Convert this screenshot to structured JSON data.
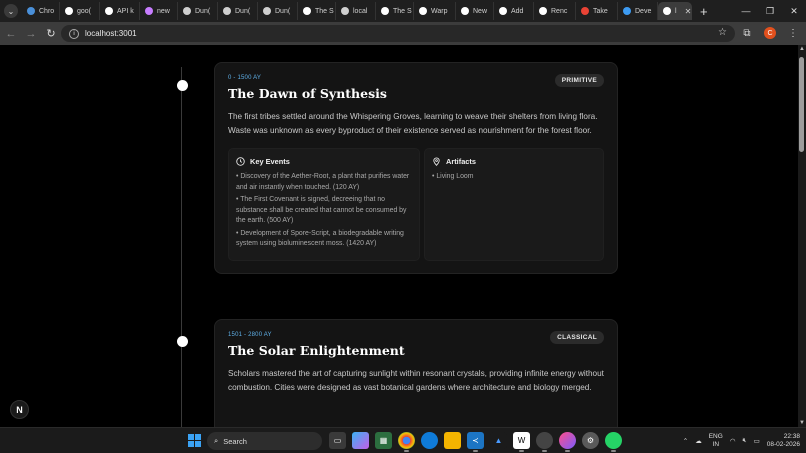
{
  "browser": {
    "tabs": [
      {
        "label": "Chro",
        "icon": "chrome-icon",
        "color": "#4a90d9"
      },
      {
        "label": "goo(",
        "icon": "github-icon",
        "color": "#ffffff"
      },
      {
        "label": "API k",
        "icon": "github-icon",
        "color": "#ffffff"
      },
      {
        "label": "new",
        "icon": "gemini-icon",
        "color": "#c77dff"
      },
      {
        "label": "Dun(",
        "icon": "openai-icon",
        "color": "#cfcfcf"
      },
      {
        "label": "Dun(",
        "icon": "openai-icon",
        "color": "#cfcfcf"
      },
      {
        "label": "Dun(",
        "icon": "openai-icon",
        "color": "#cfcfcf"
      },
      {
        "label": "The S",
        "icon": "vercel-icon",
        "color": "#ffffff"
      },
      {
        "label": "local",
        "icon": "globe-icon",
        "color": "#cfcfcf"
      },
      {
        "label": "The S",
        "icon": "vercel-icon",
        "color": "#ffffff"
      },
      {
        "label": "Warp",
        "icon": "warp-icon",
        "color": "#ffffff"
      },
      {
        "label": "New",
        "icon": "vercel-icon",
        "color": "#ffffff"
      },
      {
        "label": "Add",
        "icon": "github-icon",
        "color": "#ffffff"
      },
      {
        "label": "Renc",
        "icon": "render-icon",
        "color": "#ffffff"
      },
      {
        "label": "Take",
        "icon": "gmail-icon",
        "color": "#ea4335"
      },
      {
        "label": "Deve",
        "icon": "devpost-icon",
        "color": "#3d9bf2"
      },
      {
        "label": "l",
        "icon": "vercel-icon",
        "color": "#ffffff",
        "active": true
      }
    ],
    "url": "localhost:3001"
  },
  "timeline": [
    {
      "date": "0 - 1500 AY",
      "title": "The Dawn of Synthesis",
      "badge": "PRIMITIVE",
      "description": "The first tribes settled around the Whispering Groves, learning to weave their shelters from living flora. Waste was unknown as every byproduct of their existence served as nourishment for the forest floor.",
      "key_events_label": "Key Events",
      "key_events": [
        "• Discovery of the Aether-Root, a plant that purifies water and air instantly when touched. (120 AY)",
        "• The First Covenant is signed, decreeing that no substance shall be created that cannot be consumed by the earth. (500 AY)",
        "• Development of Spore-Script, a biodegradable writing system using bioluminescent moss. (1420 AY)"
      ],
      "artifacts_label": "Artifacts",
      "artifacts": [
        "• Living Loom"
      ]
    },
    {
      "date": "1501 - 2800 AY",
      "title": "The Solar Enlightenment",
      "badge": "CLASSICAL",
      "description": "Scholars mastered the art of capturing sunlight within resonant crystals, providing infinite energy without combustion. Cities were designed as vast botanical gardens where architecture and biology merged."
    }
  ],
  "dev_badge": "N",
  "taskbar": {
    "search_label": "Search",
    "lang_top": "ENG",
    "lang_bottom": "IN",
    "time": "22:38",
    "date": "08-02-2026"
  }
}
